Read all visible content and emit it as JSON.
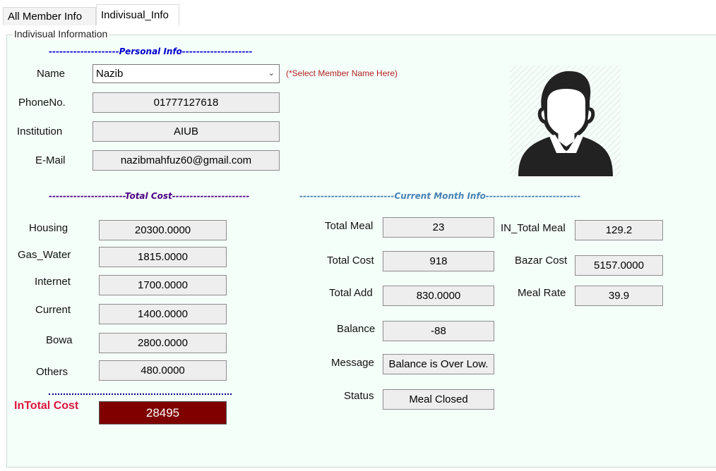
{
  "tabs": {
    "all_member": "All Member Info",
    "individual": "Indivisual_Info"
  },
  "group": {
    "title": "Indivisual Information"
  },
  "sections": {
    "personal": "--------------------Personal Info--------------------",
    "total_cost": "----------------------Total Cost----------------------",
    "current_month": "---------------------------Current Month Info---------------------------"
  },
  "personal": {
    "name_label": "Name",
    "name_value": "Nazib",
    "name_hint": "(*Select Member Name Here)",
    "phone_label": "PhoneNo.",
    "phone_value": "01777127618",
    "institution_label": "Institution",
    "institution_value": "AIUB",
    "email_label": "E-Mail",
    "email_value": "nazibmahfuz60@gmail.com"
  },
  "costs": {
    "housing_label": "Housing",
    "housing_value": "20300.0000",
    "gas_label": "Gas_Water",
    "gas_value": "1815.0000",
    "internet_label": "Internet",
    "internet_value": "1700.0000",
    "current_label": "Current",
    "current_value": "1400.0000",
    "bowa_label": "Bowa",
    "bowa_value": "2800.0000",
    "others_label": "Others",
    "others_value": "480.0000",
    "intotal_label": "InTotal Cost",
    "intotal_value": "28495"
  },
  "month": {
    "total_meal_label": "Total Meal",
    "total_meal_value": "23",
    "in_total_meal_label": "IN_Total Meal",
    "in_total_meal_value": "129.2",
    "total_cost_label": "Total Cost",
    "total_cost_value": "918",
    "bazar_cost_label": "Bazar Cost",
    "bazar_cost_value": "5157.0000",
    "total_add_label": "Total Add",
    "total_add_value": "830.0000",
    "meal_rate_label": "Meal Rate",
    "meal_rate_value": "39.9",
    "balance_label": "Balance",
    "balance_value": "-88",
    "message_label": "Message",
    "message_value": "Balance is Over Low.",
    "status_label": "Status",
    "status_value": "Meal Closed"
  },
  "colors": {
    "personal_header": "#0000cd",
    "total_cost_header": "#4b0082",
    "current_month_header": "#4682b4",
    "intotal_bg": "#800000",
    "intotal_label": "#dc143c"
  },
  "icons": {
    "avatar": "user-avatar-icon",
    "dropdown": "chevron-down-icon"
  }
}
